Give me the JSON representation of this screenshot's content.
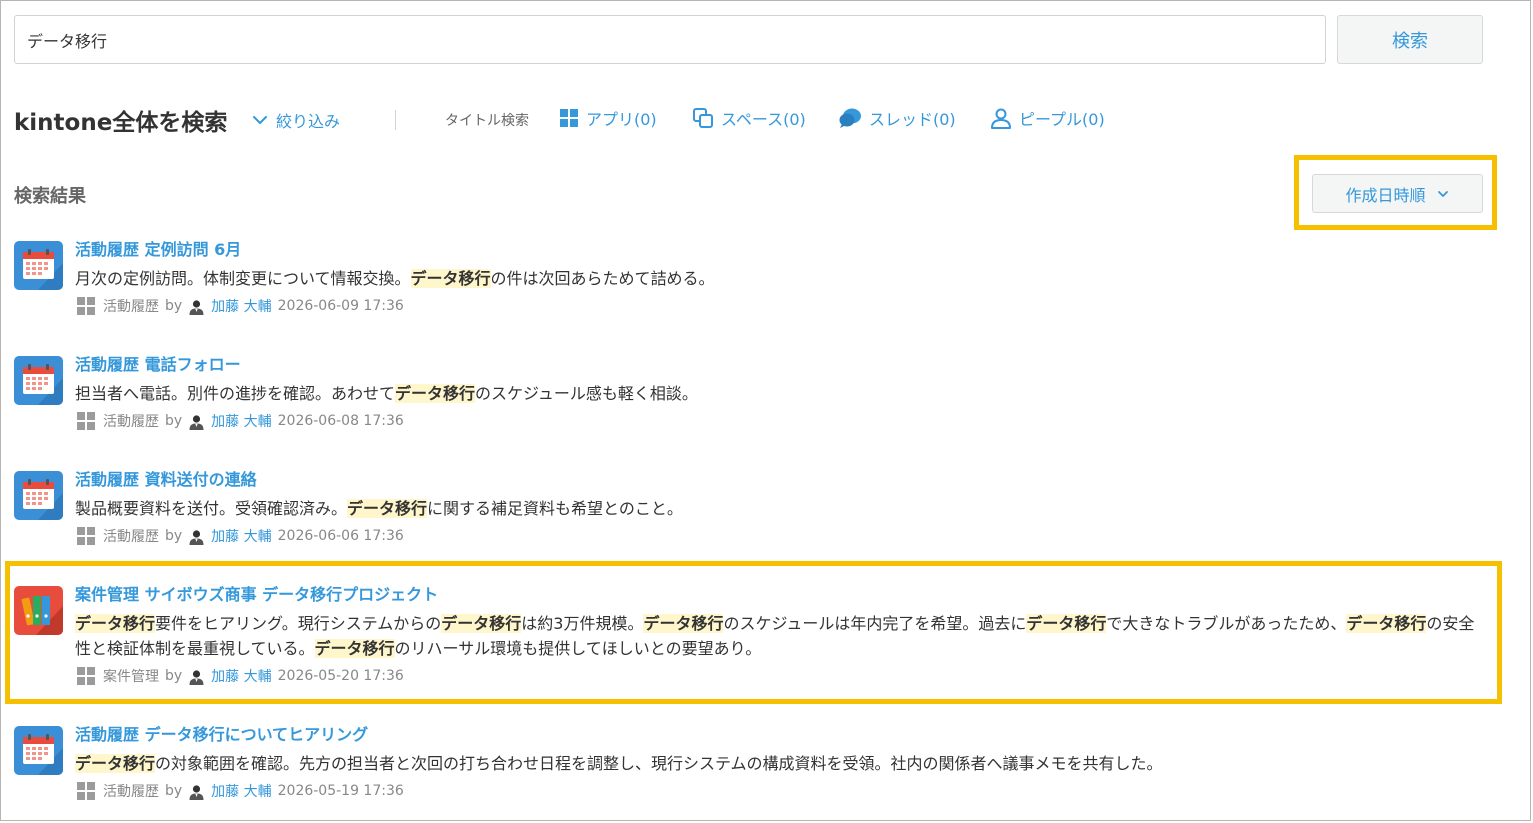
{
  "search": {
    "value": "データ移行",
    "button_label": "検索"
  },
  "scope": {
    "title": "kintone全体を検索",
    "filter_label": "絞り込み",
    "title_search_label": "タイトル検索",
    "categories": [
      {
        "label": "アプリ(0)",
        "icon": "apps-grid-icon"
      },
      {
        "label": "スペース(0)",
        "icon": "space-icon"
      },
      {
        "label": "スレッド(0)",
        "icon": "thread-bubble-icon"
      },
      {
        "label": "ピープル(0)",
        "icon": "people-icon"
      }
    ]
  },
  "results": {
    "heading": "検索結果",
    "sort_label": "作成日時順",
    "highlight_color": "#fff6cc",
    "accent_color": "#3498db",
    "callout_color": "#f5c000",
    "items": [
      {
        "app_icon": "calendar-app-icon",
        "title": "活動履歴 定例訪問 6月",
        "snippet": [
          {
            "t": "月次の定例訪問。体制変更について情報交換。"
          },
          {
            "t": "データ移行",
            "h": true
          },
          {
            "t": "の件は次回あらためて詰める。"
          }
        ],
        "app_name": "活動履歴",
        "by": "by",
        "user": "加藤 大輔",
        "datetime": "2026-06-09 17:36"
      },
      {
        "app_icon": "calendar-app-icon",
        "title": "活動履歴 電話フォロー",
        "snippet": [
          {
            "t": "担当者へ電話。別件の進捗を確認。あわせて"
          },
          {
            "t": "データ移行",
            "h": true
          },
          {
            "t": "のスケジュール感も軽く相談。"
          }
        ],
        "app_name": "活動履歴",
        "by": "by",
        "user": "加藤 大輔",
        "datetime": "2026-06-08 17:36"
      },
      {
        "app_icon": "calendar-app-icon",
        "title": "活動履歴 資料送付の連絡",
        "snippet": [
          {
            "t": "製品概要資料を送付。受領確認済み。"
          },
          {
            "t": "データ移行",
            "h": true
          },
          {
            "t": "に関する補足資料も希望とのこと。"
          }
        ],
        "app_name": "活動履歴",
        "by": "by",
        "user": "加藤 大輔",
        "datetime": "2026-06-06 17:36"
      },
      {
        "app_icon": "binders-app-icon",
        "title": "案件管理 サイボウズ商事 データ移行プロジェクト",
        "snippet": [
          {
            "t": "データ移行",
            "h": true
          },
          {
            "t": "要件をヒアリング。現行システムからの"
          },
          {
            "t": "データ移行",
            "h": true
          },
          {
            "t": "は約3万件規模。"
          },
          {
            "t": "データ移行",
            "h": true
          },
          {
            "t": "のスケジュールは年内完了を希望。過去に"
          },
          {
            "t": "データ移行",
            "h": true
          },
          {
            "t": "で大きなトラブルがあったため、"
          },
          {
            "t": "データ移行",
            "h": true
          },
          {
            "t": "の安全性と検証体制を最重視している。"
          },
          {
            "t": "データ移行",
            "h": true
          },
          {
            "t": "のリハーサル環境も提供してほしいとの要望あり。"
          }
        ],
        "app_name": "案件管理",
        "by": "by",
        "user": "加藤 大輔",
        "datetime": "2026-05-20 17:36"
      },
      {
        "app_icon": "calendar-app-icon",
        "title": "活動履歴 データ移行についてヒアリング",
        "snippet": [
          {
            "t": "データ移行",
            "h": true
          },
          {
            "t": "の対象範囲を確認。先方の担当者と次回の打ち合わせ日程を調整し、現行システムの構成資料を受領。社内の関係者へ議事メモを共有した。"
          }
        ],
        "app_name": "活動履歴",
        "by": "by",
        "user": "加藤 大輔",
        "datetime": "2026-05-19 17:36"
      }
    ]
  }
}
